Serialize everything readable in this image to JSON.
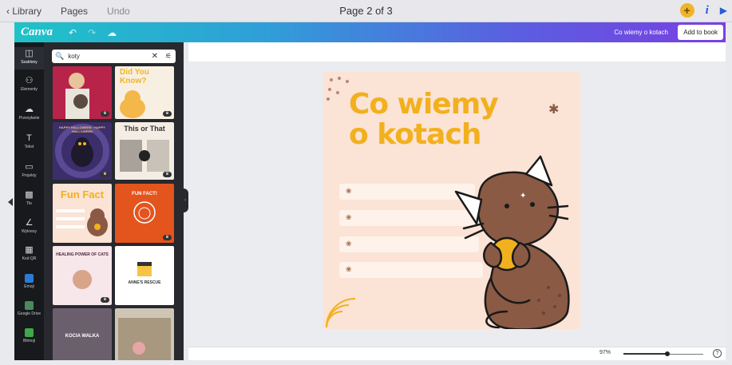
{
  "host": {
    "back_label": "‹ Library",
    "pages_label": "Pages",
    "undo_label": "Undo",
    "page_indicator": "Page 2 of 3",
    "plus_symbol": "+",
    "info_symbol": "i",
    "play_symbol": "▶"
  },
  "canva": {
    "logo": "Canva",
    "undo_icon": "↶",
    "redo_icon": "↷",
    "cloud_icon": "☁",
    "doc_title": "Co wiemy o kotach",
    "add_to_book": "Add to book",
    "accent_gradient": [
      "#1ec3c7",
      "#5a5fe0",
      "#7a3fe3"
    ]
  },
  "sidebar": {
    "items": [
      {
        "label": "Szablony",
        "icon": "template-icon",
        "glyph": "◫"
      },
      {
        "label": "Elementy",
        "icon": "elements-icon",
        "glyph": "⚇"
      },
      {
        "label": "Przesyłanie",
        "icon": "upload-icon",
        "glyph": "☁"
      },
      {
        "label": "Tekst",
        "icon": "text-icon",
        "glyph": "T"
      },
      {
        "label": "Projekty",
        "icon": "folder-icon",
        "glyph": "▭"
      },
      {
        "label": "Tło",
        "icon": "background-icon",
        "glyph": "▩"
      },
      {
        "label": "Wykresy",
        "icon": "chart-icon",
        "glyph": "∠"
      },
      {
        "label": "Kod QR",
        "icon": "qr-icon",
        "glyph": "▦"
      },
      {
        "label": "Emoji",
        "icon": "emoji-app-icon",
        "glyph": ""
      },
      {
        "label": "Google Drive",
        "icon": "google-drive-icon",
        "glyph": ""
      },
      {
        "label": "Bitmoji",
        "icon": "bitmoji-icon",
        "glyph": ""
      }
    ]
  },
  "panel": {
    "search_value": "koty",
    "search_icon": "🔍",
    "clear_icon": "✕",
    "filter_icon": "⚟",
    "thumbs": [
      {
        "title": ""
      },
      {
        "title": "Did You Know?"
      },
      {
        "title": "HAPPY HALLOWEEN · HAPPY HALLOWEEN"
      },
      {
        "title": "This or That"
      },
      {
        "title": "Fun Fact"
      },
      {
        "title": "FUN FACT!"
      },
      {
        "title": "HEALING POWER OF CATS"
      },
      {
        "title": "ANNE'S RESCUE"
      },
      {
        "title": "KOCIA WALKA"
      },
      {
        "title": ""
      }
    ]
  },
  "design": {
    "title_line1": "Co wiemy",
    "title_line2": "o kotach",
    "title_color": "#f2b01e",
    "background_color": "#fbe3d5"
  },
  "zoom": {
    "value_label": "97%",
    "level_fraction": 0.97,
    "help_symbol": "?"
  }
}
